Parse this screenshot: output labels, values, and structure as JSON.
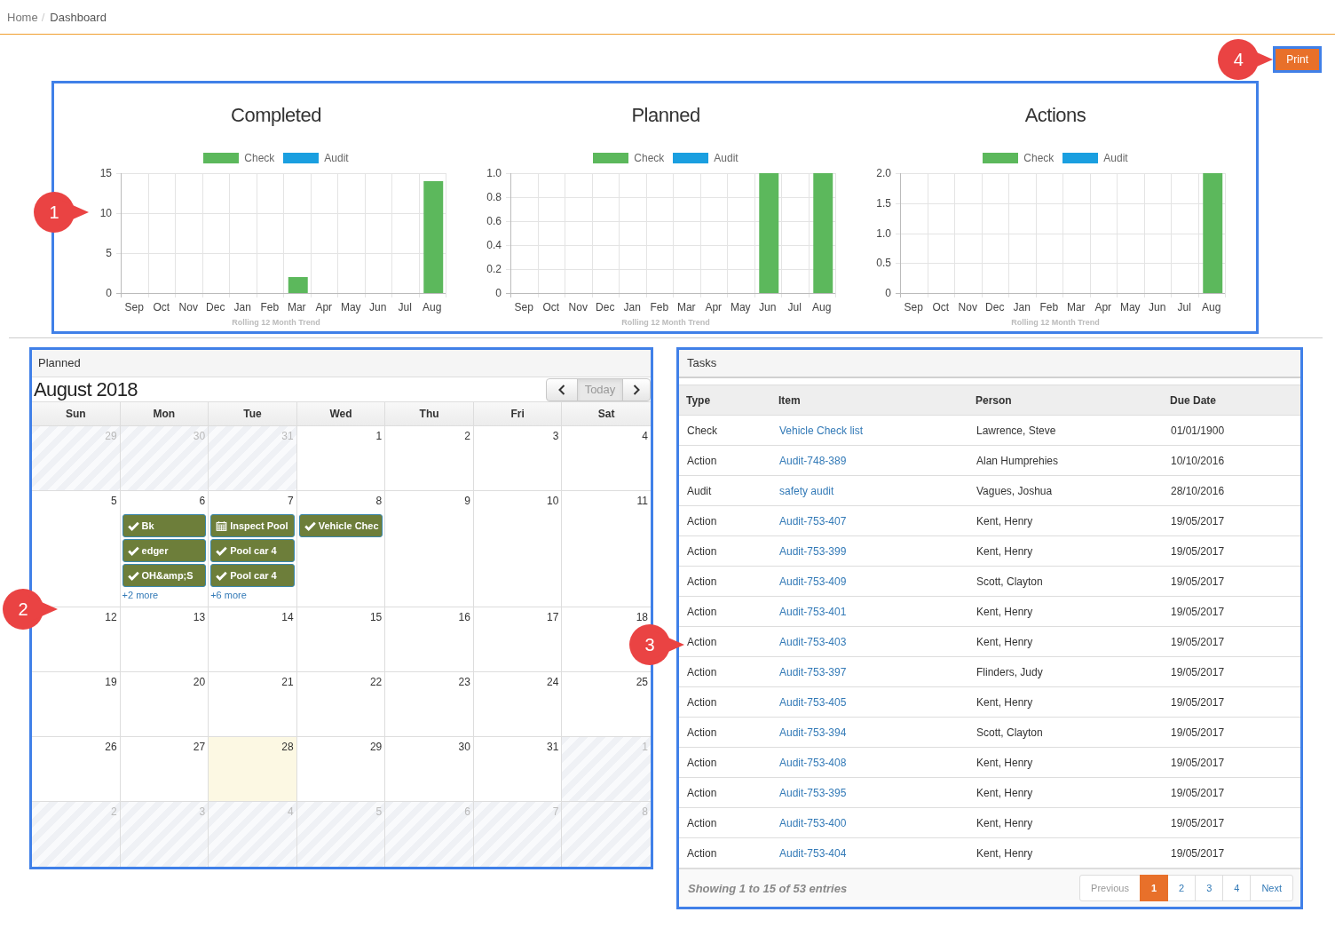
{
  "breadcrumb": {
    "items": [
      "Home",
      "Dashboard"
    ],
    "separator": "/"
  },
  "print_button": {
    "label": "Print",
    "callout": "4"
  },
  "charts": {
    "callout": "1",
    "items": [
      {
        "chart_data": {
          "type": "bar",
          "title": "Completed",
          "xlabel": "Rolling 12 Month Trend",
          "categories": [
            "Sep",
            "Oct",
            "Nov",
            "Dec",
            "Jan",
            "Feb",
            "Mar",
            "Apr",
            "May",
            "Jun",
            "Jul",
            "Aug"
          ],
          "series": [
            {
              "name": "Check",
              "color": "#5cb85c",
              "values": [
                0,
                0,
                0,
                0,
                0,
                0,
                2,
                0,
                0,
                0,
                0,
                14
              ]
            },
            {
              "name": "Audit",
              "color": "#1a9fe0",
              "values": [
                0,
                0,
                0,
                0,
                0,
                0,
                0,
                0,
                0,
                0,
                0,
                0
              ]
            }
          ],
          "ylim": [
            0,
            15
          ],
          "yticks": [
            0,
            5,
            10,
            15
          ],
          "stacked": true,
          "grid": true
        }
      },
      {
        "chart_data": {
          "type": "bar",
          "title": "Planned",
          "xlabel": "Rolling 12 Month Trend",
          "categories": [
            "Sep",
            "Oct",
            "Nov",
            "Dec",
            "Jan",
            "Feb",
            "Mar",
            "Apr",
            "May",
            "Jun",
            "Jul",
            "Aug"
          ],
          "series": [
            {
              "name": "Check",
              "color": "#5cb85c",
              "values": [
                0,
                0,
                0,
                0,
                0,
                0,
                0,
                0,
                0,
                1,
                0,
                1
              ]
            },
            {
              "name": "Audit",
              "color": "#1a9fe0",
              "values": [
                0,
                0,
                0,
                0,
                0,
                0,
                0,
                0,
                0,
                0,
                0,
                0
              ]
            }
          ],
          "ylim": [
            0,
            1
          ],
          "yticks": [
            0,
            {
              "value": 0.2,
              "label": "0.2"
            },
            {
              "value": 0.4,
              "label": "0.4"
            },
            {
              "value": 0.6,
              "label": "0.6"
            },
            {
              "value": 0.8,
              "label": "0.8"
            },
            {
              "value": 1,
              "label": "1.0"
            }
          ],
          "stacked": true,
          "grid": true
        }
      },
      {
        "chart_data": {
          "type": "bar",
          "title": "Actions",
          "xlabel": "Rolling 12 Month Trend",
          "categories": [
            "Sep",
            "Oct",
            "Nov",
            "Dec",
            "Jan",
            "Feb",
            "Mar",
            "Apr",
            "May",
            "Jun",
            "Jul",
            "Aug"
          ],
          "series": [
            {
              "name": "Check",
              "color": "#5cb85c",
              "values": [
                0,
                0,
                0,
                0,
                0,
                0,
                0,
                0,
                0,
                0,
                0,
                2
              ]
            },
            {
              "name": "Audit",
              "color": "#1a9fe0",
              "values": [
                0,
                0,
                0,
                0,
                0,
                0,
                0,
                0,
                0,
                0,
                0,
                0
              ]
            }
          ],
          "ylim": [
            0,
            2
          ],
          "yticks": [
            0,
            {
              "value": 0.5,
              "label": "0.5"
            },
            {
              "value": 1,
              "label": "1.0"
            },
            {
              "value": 1.5,
              "label": "1.5"
            },
            {
              "value": 2,
              "label": "2.0"
            }
          ],
          "stacked": true,
          "grid": true
        }
      }
    ]
  },
  "calendar": {
    "panel_title": "Planned",
    "title": "August 2018",
    "today_button": {
      "label": "Today",
      "disabled": true
    },
    "callout": "2",
    "day_headers": [
      "Sun",
      "Mon",
      "Tue",
      "Wed",
      "Thu",
      "Fri",
      "Sat"
    ],
    "weeks": [
      [
        {
          "day": "29",
          "other_month": true,
          "today": false
        },
        {
          "day": "30",
          "other_month": true,
          "today": false
        },
        {
          "day": "31",
          "other_month": true,
          "today": false
        },
        {
          "day": "1",
          "other_month": false,
          "today": false
        },
        {
          "day": "2",
          "other_month": false,
          "today": false
        },
        {
          "day": "3",
          "other_month": false,
          "today": false
        },
        {
          "day": "4",
          "other_month": false,
          "today": false
        }
      ],
      [
        {
          "day": "5",
          "other_month": false,
          "today": false
        },
        {
          "day": "6",
          "other_month": false,
          "today": false,
          "events": [
            {
              "label": "Bk",
              "kind": "check"
            },
            {
              "label": "edger",
              "kind": "check"
            },
            {
              "label": "OH&amp;S",
              "kind": "check"
            }
          ],
          "more": "+2 more"
        },
        {
          "day": "7",
          "other_month": false,
          "today": false,
          "events": [
            {
              "label": "Inspect Pool",
              "kind": "calendar"
            },
            {
              "label": "Pool car 4",
              "kind": "check"
            },
            {
              "label": "Pool car 4",
              "kind": "check"
            }
          ],
          "more": "+6 more"
        },
        {
          "day": "8",
          "other_month": false,
          "today": false,
          "events": [
            {
              "label": "Vehicle Chec",
              "kind": "check"
            }
          ]
        },
        {
          "day": "9",
          "other_month": false,
          "today": false
        },
        {
          "day": "10",
          "other_month": false,
          "today": false
        },
        {
          "day": "11",
          "other_month": false,
          "today": false
        }
      ],
      [
        {
          "day": "12",
          "other_month": false,
          "today": false
        },
        {
          "day": "13",
          "other_month": false,
          "today": false
        },
        {
          "day": "14",
          "other_month": false,
          "today": false
        },
        {
          "day": "15",
          "other_month": false,
          "today": false
        },
        {
          "day": "16",
          "other_month": false,
          "today": false
        },
        {
          "day": "17",
          "other_month": false,
          "today": false
        },
        {
          "day": "18",
          "other_month": false,
          "today": false
        }
      ],
      [
        {
          "day": "19",
          "other_month": false,
          "today": false
        },
        {
          "day": "20",
          "other_month": false,
          "today": false
        },
        {
          "day": "21",
          "other_month": false,
          "today": false
        },
        {
          "day": "22",
          "other_month": false,
          "today": false
        },
        {
          "day": "23",
          "other_month": false,
          "today": false
        },
        {
          "day": "24",
          "other_month": false,
          "today": false
        },
        {
          "day": "25",
          "other_month": false,
          "today": false
        }
      ],
      [
        {
          "day": "26",
          "other_month": false,
          "today": false
        },
        {
          "day": "27",
          "other_month": false,
          "today": false
        },
        {
          "day": "28",
          "other_month": false,
          "today": true
        },
        {
          "day": "29",
          "other_month": false,
          "today": false
        },
        {
          "day": "30",
          "other_month": false,
          "today": false
        },
        {
          "day": "31",
          "other_month": false,
          "today": false
        },
        {
          "day": "1",
          "other_month": true,
          "today": false
        }
      ],
      [
        {
          "day": "2",
          "other_month": true,
          "today": false
        },
        {
          "day": "3",
          "other_month": true,
          "today": false
        },
        {
          "day": "4",
          "other_month": true,
          "today": false
        },
        {
          "day": "5",
          "other_month": true,
          "today": false
        },
        {
          "day": "6",
          "other_month": true,
          "today": false
        },
        {
          "day": "7",
          "other_month": true,
          "today": false
        },
        {
          "day": "8",
          "other_month": true,
          "today": false
        }
      ]
    ]
  },
  "tasks": {
    "panel_title": "Tasks",
    "callout": "3",
    "columns": [
      "Type",
      "Item",
      "Person",
      "Due Date"
    ],
    "rows": [
      {
        "type": "Check",
        "item": "Vehicle Check list",
        "person": "Lawrence, Steve",
        "due_date": "01/01/1900"
      },
      {
        "type": "Action",
        "item": "Audit-748-389",
        "person": "Alan Humprehies",
        "due_date": "10/10/2016"
      },
      {
        "type": "Audit",
        "item": "safety audit",
        "person": "Vagues, Joshua",
        "due_date": "28/10/2016"
      },
      {
        "type": "Action",
        "item": "Audit-753-407",
        "person": "Kent, Henry",
        "due_date": "19/05/2017"
      },
      {
        "type": "Action",
        "item": "Audit-753-399",
        "person": "Kent, Henry",
        "due_date": "19/05/2017"
      },
      {
        "type": "Action",
        "item": "Audit-753-409",
        "person": "Scott, Clayton",
        "due_date": "19/05/2017"
      },
      {
        "type": "Action",
        "item": "Audit-753-401",
        "person": "Kent, Henry",
        "due_date": "19/05/2017"
      },
      {
        "type": "Action",
        "item": "Audit-753-403",
        "person": "Kent, Henry",
        "due_date": "19/05/2017"
      },
      {
        "type": "Action",
        "item": "Audit-753-397",
        "person": "Flinders, Judy",
        "due_date": "19/05/2017"
      },
      {
        "type": "Action",
        "item": "Audit-753-405",
        "person": "Kent, Henry",
        "due_date": "19/05/2017"
      },
      {
        "type": "Action",
        "item": "Audit-753-394",
        "person": "Scott, Clayton",
        "due_date": "19/05/2017"
      },
      {
        "type": "Action",
        "item": "Audit-753-408",
        "person": "Kent, Henry",
        "due_date": "19/05/2017"
      },
      {
        "type": "Action",
        "item": "Audit-753-395",
        "person": "Kent, Henry",
        "due_date": "19/05/2017"
      },
      {
        "type": "Action",
        "item": "Audit-753-400",
        "person": "Kent, Henry",
        "due_date": "19/05/2017"
      },
      {
        "type": "Action",
        "item": "Audit-753-404",
        "person": "Kent, Henry",
        "due_date": "19/05/2017"
      }
    ],
    "summary": "Showing 1 to 15 of 53 entries",
    "pagination": [
      {
        "label": "Previous",
        "disabled": true,
        "selected": false
      },
      {
        "label": "1",
        "disabled": false,
        "selected": true
      },
      {
        "label": "2",
        "disabled": false,
        "selected": false
      },
      {
        "label": "3",
        "disabled": false,
        "selected": false
      },
      {
        "label": "4",
        "disabled": false,
        "selected": false
      },
      {
        "label": "Next",
        "disabled": false,
        "selected": false
      }
    ]
  }
}
